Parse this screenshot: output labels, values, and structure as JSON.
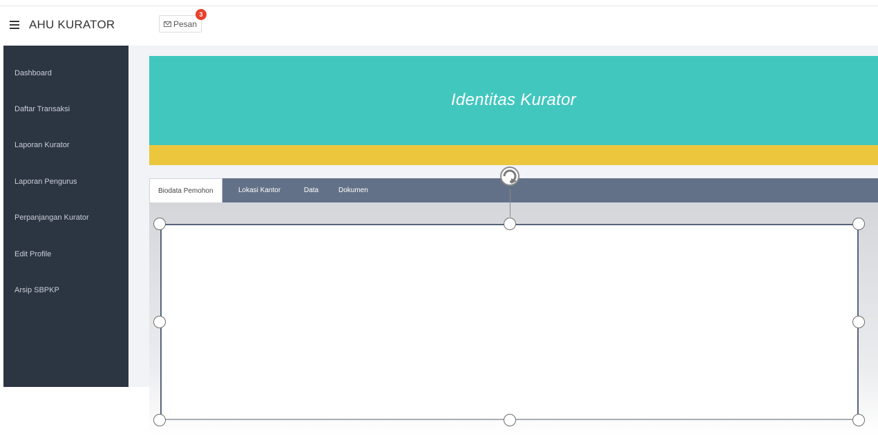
{
  "app": {
    "title": "AHU KURATOR"
  },
  "header": {
    "messages_label": "Pesan",
    "messages_count": "3"
  },
  "sidebar": {
    "items": [
      {
        "label": "Dashboard"
      },
      {
        "label": "Daftar Transaksi"
      },
      {
        "label": "Laporan Kurator"
      },
      {
        "label": "Laporan Pengurus"
      },
      {
        "label": "Perpanjangan Kurator"
      },
      {
        "label": "Edit Profile"
      },
      {
        "label": "Arsip SBPKP"
      }
    ]
  },
  "hero": {
    "title": "Identitas Kurator"
  },
  "tabs": [
    {
      "label": "Biodata Pemohon",
      "active": true
    },
    {
      "label": "Lokasi Kantor",
      "active": false
    },
    {
      "label": "Data",
      "active": false
    },
    {
      "label": "Dokumen",
      "active": false
    }
  ],
  "colors": {
    "sidebar_bg": "#2c3542",
    "hero_teal": "#42c7bf",
    "hero_yellow": "#ecc73e",
    "tabbar_bg": "#637188",
    "badge": "#e8412c"
  },
  "icons": {
    "menu": "hamburger-icon",
    "message": "envelope-icon",
    "rotate": "rotate-icon"
  }
}
